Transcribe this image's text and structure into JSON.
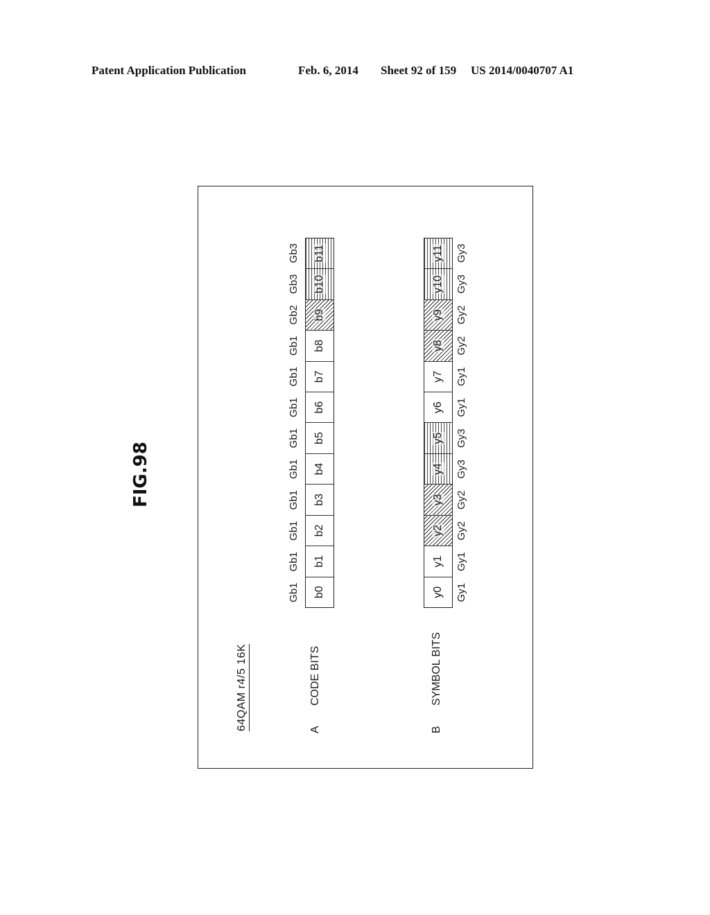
{
  "header": {
    "publication": "Patent Application Publication",
    "date": "Feb. 6, 2014",
    "sheet": "Sheet 92 of 159",
    "number": "US 2014/0040707 A1"
  },
  "figure": {
    "label": "FIG.98",
    "title": "64QAM r4/5 16K",
    "rows": [
      {
        "letter": "A",
        "name": "CODE BITS",
        "cells": [
          {
            "label": "b0",
            "group": "Gb1"
          },
          {
            "label": "b1",
            "group": "Gb1"
          },
          {
            "label": "b2",
            "group": "Gb1"
          },
          {
            "label": "b3",
            "group": "Gb1"
          },
          {
            "label": "b4",
            "group": "Gb1"
          },
          {
            "label": "b5",
            "group": "Gb1"
          },
          {
            "label": "b6",
            "group": "Gb1"
          },
          {
            "label": "b7",
            "group": "Gb1"
          },
          {
            "label": "b8",
            "group": "Gb1"
          },
          {
            "label": "b9",
            "group": "Gb2"
          },
          {
            "label": "b10",
            "group": "Gb3"
          },
          {
            "label": "b11",
            "group": "Gb3"
          }
        ]
      },
      {
        "letter": "B",
        "name": "SYMBOL BITS",
        "cells": [
          {
            "label": "y0",
            "group": "Gy1"
          },
          {
            "label": "y1",
            "group": "Gy1"
          },
          {
            "label": "y2",
            "group": "Gy2"
          },
          {
            "label": "y3",
            "group": "Gy2"
          },
          {
            "label": "y4",
            "group": "Gy3"
          },
          {
            "label": "y5",
            "group": "Gy3"
          },
          {
            "label": "y6",
            "group": "Gy1"
          },
          {
            "label": "y7",
            "group": "Gy1"
          },
          {
            "label": "y8",
            "group": "Gy2"
          },
          {
            "label": "y9",
            "group": "Gy2"
          },
          {
            "label": "y10",
            "group": "Gy3"
          },
          {
            "label": "y11",
            "group": "Gy3"
          }
        ]
      }
    ]
  }
}
